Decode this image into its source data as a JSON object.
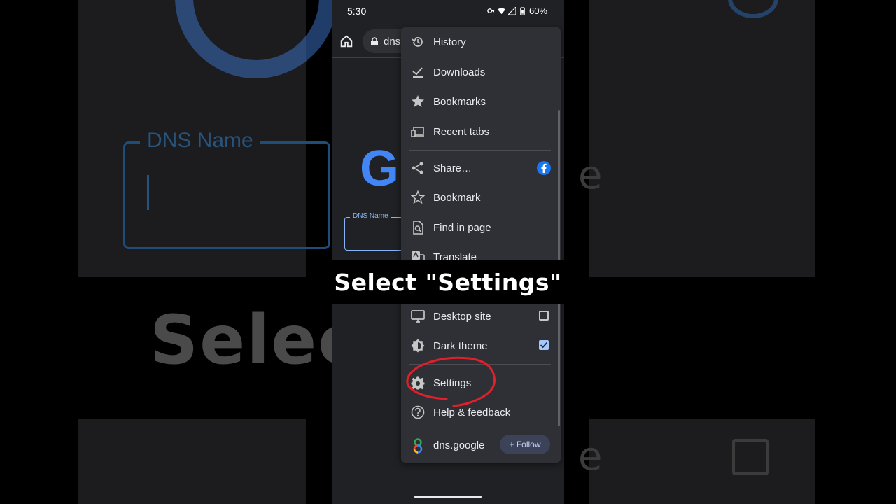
{
  "status_bar": {
    "time": "5:30",
    "battery": "60%"
  },
  "toolbar": {
    "url": "dns"
  },
  "page": {
    "dns_field_label": "DNS Name"
  },
  "background": {
    "dns_label": "DNS Name",
    "big_text": "Selec     ngs\""
  },
  "menu": {
    "items": [
      {
        "label": "History",
        "icon": "history-icon"
      },
      {
        "label": "Downloads",
        "icon": "download-check-icon"
      },
      {
        "label": "Bookmarks",
        "icon": "star-filled-icon"
      },
      {
        "label": "Recent tabs",
        "icon": "devices-icon"
      },
      {
        "label": "Share…",
        "icon": "share-icon",
        "trailing_icon": "facebook-icon"
      },
      {
        "label": "Bookmark",
        "icon": "star-outline-icon"
      },
      {
        "label": "Find in page",
        "icon": "find-in-page-icon"
      },
      {
        "label": "Translate",
        "icon": "translate-icon"
      },
      {
        "label": "Desktop site",
        "icon": "desktop-icon",
        "checked": false
      },
      {
        "label": "Dark theme",
        "icon": "dark-theme-icon",
        "checked": true
      },
      {
        "label": "Settings",
        "icon": "gear-icon"
      },
      {
        "label": "Help & feedback",
        "icon": "help-icon"
      }
    ],
    "follow": {
      "site": "dns.google",
      "button": "+ Follow"
    }
  },
  "caption": {
    "text": "Select \"Settings\""
  },
  "colors": {
    "annotation": "#e0202a",
    "accent": "#8ab4f8",
    "facebook": "#1877f2"
  }
}
